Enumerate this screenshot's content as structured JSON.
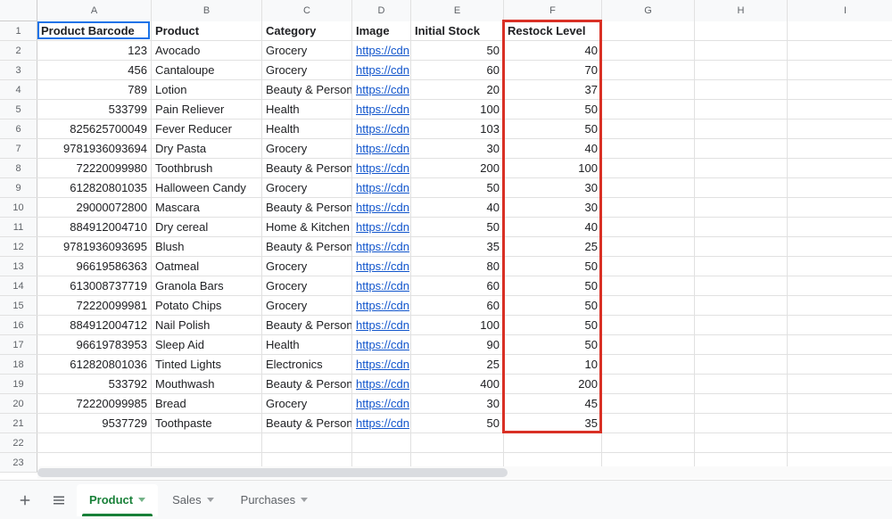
{
  "columns": {
    "letters": [
      "A",
      "B",
      "C",
      "D",
      "E",
      "F",
      "G",
      "H",
      "I"
    ],
    "widths": [
      128,
      124,
      101,
      66,
      104,
      110,
      104,
      104,
      130
    ]
  },
  "headers": {
    "A": "Product Barcode",
    "B": "Product",
    "C": "Category",
    "D": "Image",
    "E": "Initial Stock",
    "F": "Restock Level"
  },
  "link_text": "https://cdn",
  "rows": [
    {
      "barcode": "123",
      "product": "Avocado",
      "category": "Grocery",
      "initial": "50",
      "restock": "40"
    },
    {
      "barcode": "456",
      "product": "Cantaloupe",
      "category": "Grocery",
      "initial": "60",
      "restock": "70"
    },
    {
      "barcode": "789",
      "product": "Lotion",
      "category": "Beauty & Personal",
      "initial": "20",
      "restock": "37"
    },
    {
      "barcode": "533799",
      "product": "Pain Reliever",
      "category": "Health",
      "initial": "100",
      "restock": "50"
    },
    {
      "barcode": "825625700049",
      "product": "Fever Reducer",
      "category": "Health",
      "initial": "103",
      "restock": "50"
    },
    {
      "barcode": "9781936093694",
      "product": "Dry Pasta",
      "category": "Grocery",
      "initial": "30",
      "restock": "40"
    },
    {
      "barcode": "72220099980",
      "product": "Toothbrush",
      "category": "Beauty & Personal",
      "initial": "200",
      "restock": "100"
    },
    {
      "barcode": "612820801035",
      "product": "Halloween Candy",
      "category": "Grocery",
      "initial": "50",
      "restock": "30"
    },
    {
      "barcode": "29000072800",
      "product": "Mascara",
      "category": "Beauty & Personal",
      "initial": "40",
      "restock": "30"
    },
    {
      "barcode": "884912004710",
      "product": "Dry cereal",
      "category": "Home & Kitchen",
      "initial": "50",
      "restock": "40"
    },
    {
      "barcode": "9781936093695",
      "product": "Blush",
      "category": "Beauty & Personal",
      "initial": "35",
      "restock": "25"
    },
    {
      "barcode": "96619586363",
      "product": "Oatmeal",
      "category": "Grocery",
      "initial": "80",
      "restock": "50"
    },
    {
      "barcode": "613008737719",
      "product": "Granola Bars",
      "category": "Grocery",
      "initial": "60",
      "restock": "50"
    },
    {
      "barcode": "72220099981",
      "product": "Potato Chips",
      "category": "Grocery",
      "initial": "60",
      "restock": "50"
    },
    {
      "barcode": "884912004712",
      "product": "Nail Polish",
      "category": "Beauty & Personal",
      "initial": "100",
      "restock": "50"
    },
    {
      "barcode": "96619783953",
      "product": "Sleep Aid",
      "category": "Health",
      "initial": "90",
      "restock": "50"
    },
    {
      "barcode": "612820801036",
      "product": "Tinted Lights",
      "category": "Electronics",
      "initial": "25",
      "restock": "10"
    },
    {
      "barcode": "533792",
      "product": "Mouthwash",
      "category": "Beauty & Personal",
      "initial": "400",
      "restock": "200"
    },
    {
      "barcode": "72220099985",
      "product": "Bread",
      "category": "Grocery",
      "initial": "30",
      "restock": "45"
    },
    {
      "barcode": "9537729",
      "product": "Toothpaste",
      "category": "Beauty & Personal",
      "initial": "50",
      "restock": "35"
    }
  ],
  "empty_rows_below": 2,
  "tabs": {
    "items": [
      {
        "label": "Product",
        "active": true
      },
      {
        "label": "Sales",
        "active": false
      },
      {
        "label": "Purchases",
        "active": false
      }
    ]
  },
  "highlight": {
    "active_cell": "A1",
    "red_box_column": "F",
    "red_box_row_start": 1,
    "red_box_row_end": 21
  }
}
